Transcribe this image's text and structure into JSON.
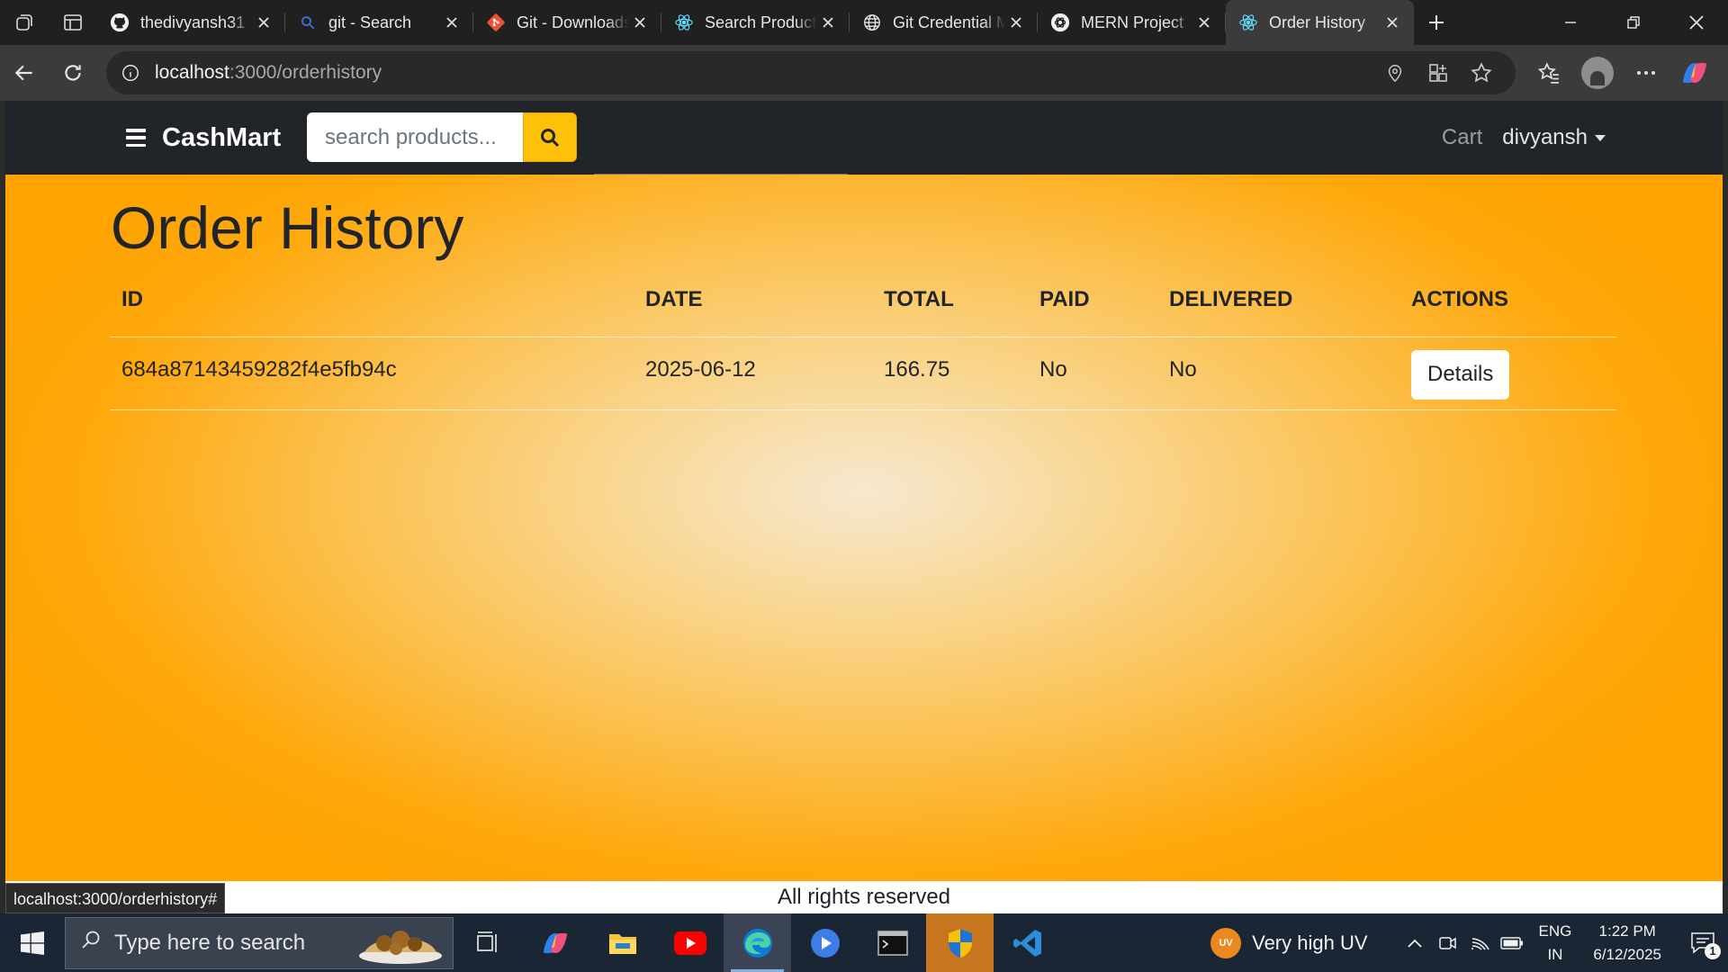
{
  "browser": {
    "tabs": [
      {
        "title": "thedivyansh31",
        "icon": "github-icon"
      },
      {
        "title": "git - Search",
        "icon": "search-icon"
      },
      {
        "title": "Git - Downloads",
        "icon": "git-icon"
      },
      {
        "title": "Search Products",
        "icon": "react-icon"
      },
      {
        "title": "Git Credential Manager",
        "icon": "globe-icon"
      },
      {
        "title": "MERN Project",
        "icon": "openai-icon"
      },
      {
        "title": "Order History",
        "icon": "react-icon",
        "active": true
      }
    ],
    "url_host": "localhost",
    "url_path": ":3000/orderhistory",
    "status_url": "localhost:3000/orderhistory#"
  },
  "site": {
    "brand": "CashMart",
    "search_placeholder": "search products...",
    "nav_cart": "Cart",
    "nav_user": "divyansh",
    "page_title": "Order History",
    "table": {
      "headers": [
        "ID",
        "DATE",
        "TOTAL",
        "PAID",
        "DELIVERED",
        "ACTIONS"
      ],
      "rows": [
        {
          "id": "684a87143459282f4e5fb94c",
          "date": "2025-06-12",
          "total": "166.75",
          "paid": "No",
          "delivered": "No",
          "action": "Details"
        }
      ]
    },
    "footer": "All rights reserved"
  },
  "taskbar": {
    "search_placeholder": "Type here to search",
    "weather": "Very high UV",
    "weather_badge": "UV",
    "lang_top": "ENG",
    "lang_bottom": "IN",
    "time": "1:22 PM",
    "date": "6/12/2025",
    "notification_count": "1"
  },
  "colors": {
    "accent": "#ffc107",
    "navbar": "#212529",
    "page_bg_outer": "#ffa300",
    "page_bg_center": "#f6e8d0"
  }
}
